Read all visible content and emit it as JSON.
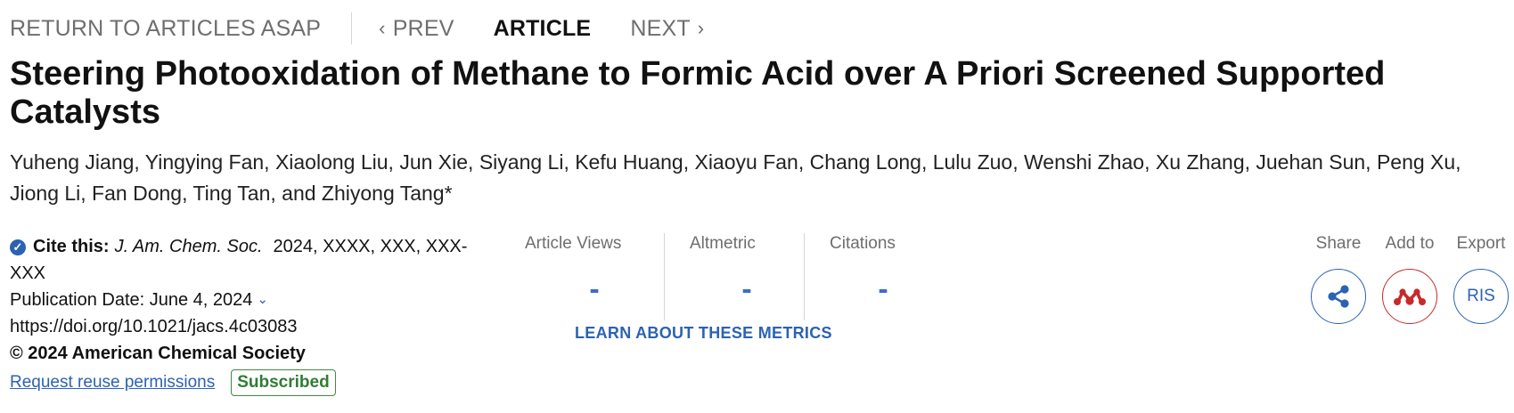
{
  "nav": {
    "return_label": "RETURN TO ARTICLES ASAP",
    "prev_label": "PREV",
    "article_label": "ARTICLE",
    "next_label": "NEXT"
  },
  "article": {
    "title": "Steering Photooxidation of Methane to Formic Acid over A Priori Screened Supported Catalysts",
    "authors": "Yuheng Jiang, Yingying Fan, Xiaolong Liu, Jun Xie, Siyang Li, Kefu Huang, Xiaoyu Fan, Chang Long, Lulu Zuo, Wenshi Zhao, Xu Zhang, Juehan Sun, Peng Xu, Jiong Li, Fan Dong, Ting Tan, and Zhiyong Tang",
    "corresponding_mark": "*",
    "cite_label": "Cite this:",
    "journal": "J. Am. Chem. Soc.",
    "cite_details": "2024, XXXX, XXX, XXX-XXX",
    "publication_date": "Publication Date: June 4, 2024",
    "doi": "https://doi.org/10.1021/jacs.4c03083",
    "copyright": "© 2024 American Chemical Society",
    "reuse_link": "Request reuse permissions",
    "access_badge": "Subscribed"
  },
  "metrics": {
    "views_label": "Article Views",
    "views_value": "-",
    "altmetric_label": "Altmetric",
    "altmetric_value": "-",
    "citations_label": "Citations",
    "citations_value": "-",
    "learn_link": "LEARN ABOUT THESE METRICS"
  },
  "actions": {
    "share_label": "Share",
    "add_label": "Add to",
    "export_label": "Export",
    "export_text": "RIS",
    "share_icon": "share-icon",
    "add_icon": "mendeley-icon"
  },
  "colors": {
    "accent": "#2c62b3",
    "metric_value": "#3b6fc0",
    "mendeley_red": "#c62a2a",
    "subscribed_green": "#2f7d32"
  }
}
